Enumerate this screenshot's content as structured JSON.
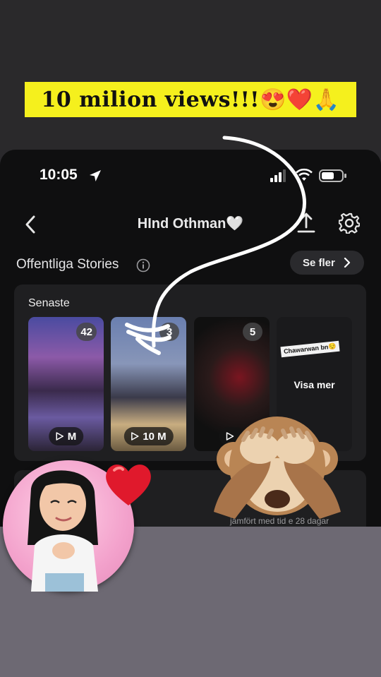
{
  "caption": {
    "text": "10 milion views!!!😍❤️🙏"
  },
  "status_bar": {
    "time": "10:05"
  },
  "header": {
    "title": "HInd Othman🤍"
  },
  "section": {
    "title": "Offentliga Stories",
    "see_more": "Se fler"
  },
  "card": {
    "title": "Senaste",
    "stories": [
      {
        "count": "42",
        "views": "M"
      },
      {
        "count": "3",
        "views": "10 M"
      },
      {
        "count": "5",
        "views": ""
      },
      {
        "label": "Visa mer",
        "tag": "Chawarwan bn😌"
      }
    ]
  },
  "compare_text": "jämfört med tid    e 28 dagar",
  "colors": {
    "caption_bg": "#f5f01d",
    "app_bg": "#0f0f10",
    "card_bg": "#1f1f21",
    "avatar_pink": "#f3a2cc"
  },
  "icons": [
    "location-arrow-icon",
    "signal-icon",
    "wifi-icon",
    "battery-icon",
    "back-chevron-icon",
    "share-icon",
    "gear-icon",
    "info-icon",
    "chevron-right-icon",
    "play-icon"
  ]
}
